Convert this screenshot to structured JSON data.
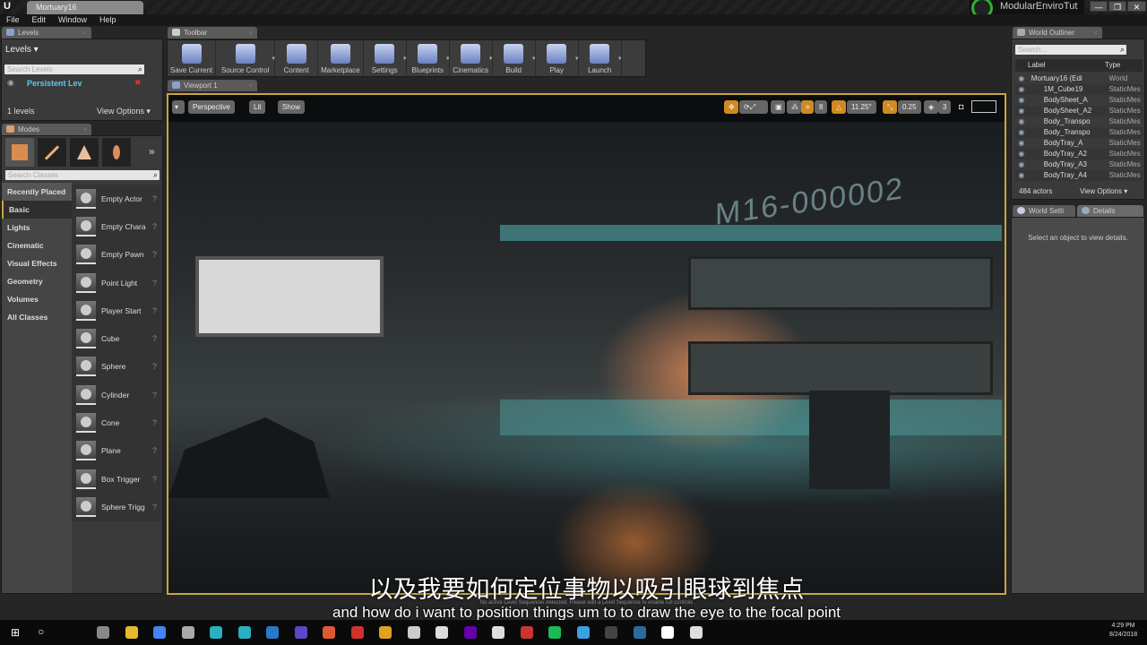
{
  "window": {
    "doc_tab": "Mortuary16",
    "project": "ModularEnviroTut",
    "min": "—",
    "max": "❐",
    "close": "✕"
  },
  "menu": [
    "File",
    "Edit",
    "Window",
    "Help"
  ],
  "levels": {
    "tab": "Levels",
    "title": "Levels ▾",
    "search_placeholder": "Search Levels",
    "persistent": "Persistent Lev",
    "count": "1 levels",
    "view_options": "View Options ▾"
  },
  "modes": {
    "tab": "Modes",
    "search_placeholder": "Search Classes",
    "more": "»",
    "categories": [
      "Recently Placed",
      "Basic",
      "Lights",
      "Cinematic",
      "Visual Effects",
      "Geometry",
      "Volumes",
      "All Classes"
    ],
    "selected_category": "Basic",
    "classes": [
      "Empty Actor",
      "Empty Chara",
      "Empty Pawn",
      "Point Light",
      "Player Start",
      "Cube",
      "Sphere",
      "Cylinder",
      "Cone",
      "Plane",
      "Box Trigger",
      "Sphere Trigg"
    ]
  },
  "toolbar": {
    "tab": "Toolbar",
    "buttons": [
      "Save Current",
      "Source Control",
      "Content",
      "Marketplace",
      "Settings",
      "Blueprints",
      "Cinematics",
      "Build",
      "Play",
      "Launch"
    ]
  },
  "viewport": {
    "tab": "Viewport 1",
    "perspective": "Perspective",
    "lit": "Lit",
    "show": "Show",
    "grid_snap": "8",
    "rot_snap": "11.25°",
    "scale_snap": "0.25",
    "cam_speed": "3",
    "sign_text": "M16-000002",
    "seq_msg": "No active Level Sequencer detected. Please edit a Level Sequence to enable full controls"
  },
  "subtitles": {
    "chinese": "以及我要如何定位事物以吸引眼球到焦点",
    "english": "and how do i want to position things um to to draw the eye to the focal point"
  },
  "outliner": {
    "tab": "World Outliner",
    "search_placeholder": "Search...",
    "col_label": "Label",
    "col_type": "Type",
    "rows": [
      {
        "label": "Mortuary16 (Edi",
        "type": "World"
      },
      {
        "label": "1M_Cube19",
        "type": "StaticMes"
      },
      {
        "label": "BodySheet_A",
        "type": "StaticMes"
      },
      {
        "label": "BodySheet_A2",
        "type": "StaticMes"
      },
      {
        "label": "Body_Transpo",
        "type": "StaticMes"
      },
      {
        "label": "Body_Transpo",
        "type": "StaticMes"
      },
      {
        "label": "BodyTray_A",
        "type": "StaticMes"
      },
      {
        "label": "BodyTray_A2",
        "type": "StaticMes"
      },
      {
        "label": "BodyTray_A3",
        "type": "StaticMes"
      },
      {
        "label": "BodyTray_A4",
        "type": "StaticMes"
      }
    ],
    "count": "484 actors",
    "view_options": "View Options ▾"
  },
  "details": {
    "tab_world": "World Setti",
    "tab_details": "Details",
    "empty": "Select an object to view details."
  },
  "taskbar": {
    "time": "4:29 PM",
    "date": "8/24/2018"
  },
  "colors": {
    "accent": "#c8a640",
    "orange": "#d08a20",
    "link": "#5ec8f0"
  }
}
